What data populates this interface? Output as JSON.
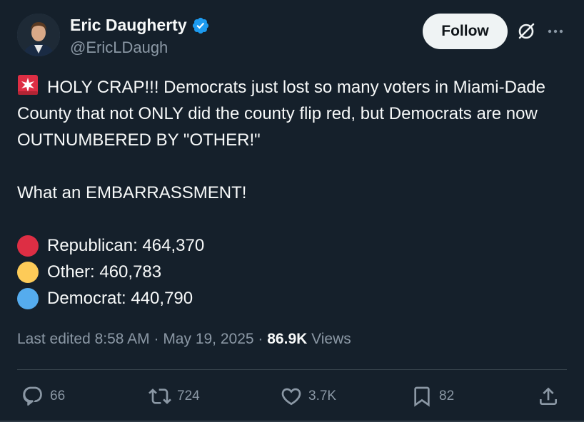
{
  "author": {
    "name": "Eric Daugherty",
    "handle": "@EricLDaugh",
    "verified": true
  },
  "header": {
    "follow_label": "Follow"
  },
  "tweet": {
    "line1": "HOLY CRAP!!! Democrats just lost so many voters in Miami-Dade County that not ONLY did the county flip red, but Democrats are now OUTNUMBERED BY \"OTHER!\"",
    "line2": "What an EMBARRASSMENT!",
    "stats": [
      {
        "label": "Republican: 464,370",
        "color": "#dd2e44"
      },
      {
        "label": "Other: 460,783",
        "color": "#fdcb58"
      },
      {
        "label": "Democrat: 440,790",
        "color": "#55acee"
      }
    ]
  },
  "meta": {
    "edited": "Last edited 8:58 AM",
    "sep1": " · ",
    "date": "May 19, 2025",
    "sep2": " · ",
    "views_count": "86.9K",
    "views_label": " Views"
  },
  "actions": {
    "replies": "66",
    "reposts": "724",
    "likes": "3.7K",
    "bookmarks": "82"
  },
  "colors": {
    "background": "#15202b",
    "text": "#f7f9f9",
    "secondary": "#8b98a5",
    "verified": "#1d9bf0"
  }
}
